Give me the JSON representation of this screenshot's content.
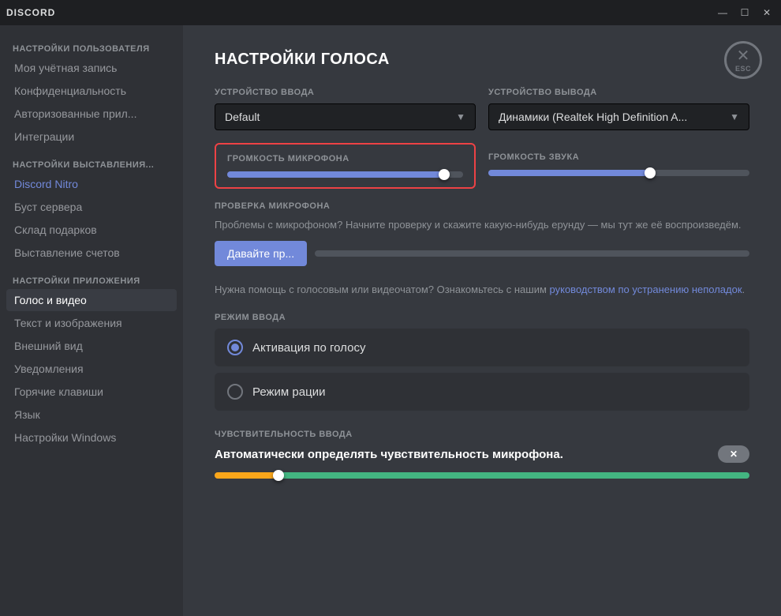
{
  "titlebar": {
    "title": "DISCORD",
    "minimize": "—",
    "maximize": "☐",
    "close": "✕"
  },
  "sidebar": {
    "sections": [
      {
        "label": "НАСТРОЙКИ ПОЛЬЗОВАТЕЛЯ",
        "items": [
          {
            "id": "my-account",
            "label": "Моя учётная запись",
            "active": false
          },
          {
            "id": "privacy",
            "label": "Конфиденциальность",
            "active": false
          },
          {
            "id": "authorized-apps",
            "label": "Авторизованные прил...",
            "active": false
          },
          {
            "id": "integrations",
            "label": "Интеграции",
            "active": false
          }
        ]
      },
      {
        "label": "НАСТРОЙКИ ВЫСТАВЛЕНИЯ...",
        "items": [
          {
            "id": "discord-nitro",
            "label": "Discord Nitro",
            "active": false,
            "highlight": true
          },
          {
            "id": "server-boost",
            "label": "Буст сервера",
            "active": false
          },
          {
            "id": "gift-inventory",
            "label": "Склад подарков",
            "active": false
          },
          {
            "id": "billing",
            "label": "Выставление счетов",
            "active": false
          }
        ]
      },
      {
        "label": "НАСТРОЙКИ ПРИЛОЖЕНИЯ",
        "items": [
          {
            "id": "voice-video",
            "label": "Голос и видео",
            "active": true
          },
          {
            "id": "text-images",
            "label": "Текст и изображения",
            "active": false
          },
          {
            "id": "appearance",
            "label": "Внешний вид",
            "active": false
          },
          {
            "id": "notifications",
            "label": "Уведомления",
            "active": false
          },
          {
            "id": "hotkeys",
            "label": "Горячие клавиши",
            "active": false
          },
          {
            "id": "language",
            "label": "Язык",
            "active": false
          },
          {
            "id": "windows-settings",
            "label": "Настройки Windows",
            "active": false
          }
        ]
      }
    ]
  },
  "content": {
    "page_title": "НАСТРОЙКИ ГОЛОСА",
    "esc_label": "ESC",
    "input_device": {
      "label": "УСТРОЙСТВО ВВОДА",
      "value": "Default",
      "options": [
        "Default"
      ]
    },
    "output_device": {
      "label": "УСТРОЙСТВО ВЫВОДА",
      "value": "Динамики (Realtek High Definition A...",
      "options": [
        "Динамики (Realtek High Definition A...)"
      ]
    },
    "mic_volume": {
      "label": "ГРОМКОСТЬ МИКРОФОНА",
      "fill_percent": 92
    },
    "sound_volume": {
      "label": "ГРОМКОСТЬ ЗВУКА",
      "fill_percent": 62
    },
    "mic_test": {
      "label": "ПРОВЕРКА МИКРОФОНА",
      "description": "Проблемы с микрофоном? Начните проверку и скажите какую-нибудь ерунду — мы тут же её воспроизведём.",
      "button_label": "Давайте пр..."
    },
    "help_text_part1": "Нужна помощь с голосовым или видеочатом? Ознакомьтесь с нашим ",
    "help_link": "руководством по устранению неполадок",
    "help_text_part2": ".",
    "input_mode": {
      "label": "РЕЖИМ ВВОДА",
      "options": [
        {
          "id": "voice-activation",
          "label": "Активация по голосу",
          "selected": true
        },
        {
          "id": "push-to-talk",
          "label": "Режим рации",
          "selected": false
        }
      ]
    },
    "sensitivity": {
      "label": "ЧУВСТВИТЕЛЬНОСТЬ ВВОДА",
      "auto_label": "Автоматически определять чувствительность микрофона.",
      "toggle_state": "off",
      "slider_orange_percent": 12
    }
  }
}
